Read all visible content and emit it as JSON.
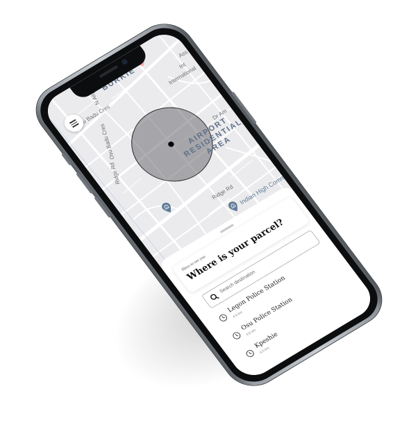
{
  "map": {
    "area_labels": [
      "BURKIE",
      "AIRPORT",
      "RESIDENTIAL",
      "AREA"
    ],
    "road_labels": [
      "N Airport",
      "Oku Badu Cres",
      "Osu Badu Cres",
      "Ridge Rd",
      "Ridge Rd",
      "Dr Am",
      "Int",
      "Ass",
      "International"
    ],
    "poi_labels": [
      "Indian High Commission"
    ],
    "icons": [
      "menu-icon",
      "heart-icon",
      "government-icon"
    ]
  },
  "sheet": {
    "greeting": "Bless to see you",
    "title": "Where is your parcel?",
    "search": {
      "placeholder": "Search destination"
    },
    "places": [
      {
        "name": "Legon Police Station",
        "distance": "4.0 km"
      },
      {
        "name": "Osu Police Station",
        "distance": "4.6 km"
      },
      {
        "name": "Kpeshie",
        "distance": "6.0 km"
      }
    ]
  },
  "colors": {
    "area_label": "#5e6f89",
    "heart": "#f4a6a6",
    "map_bg": "#ebebed",
    "circle": "#6e6e72"
  }
}
